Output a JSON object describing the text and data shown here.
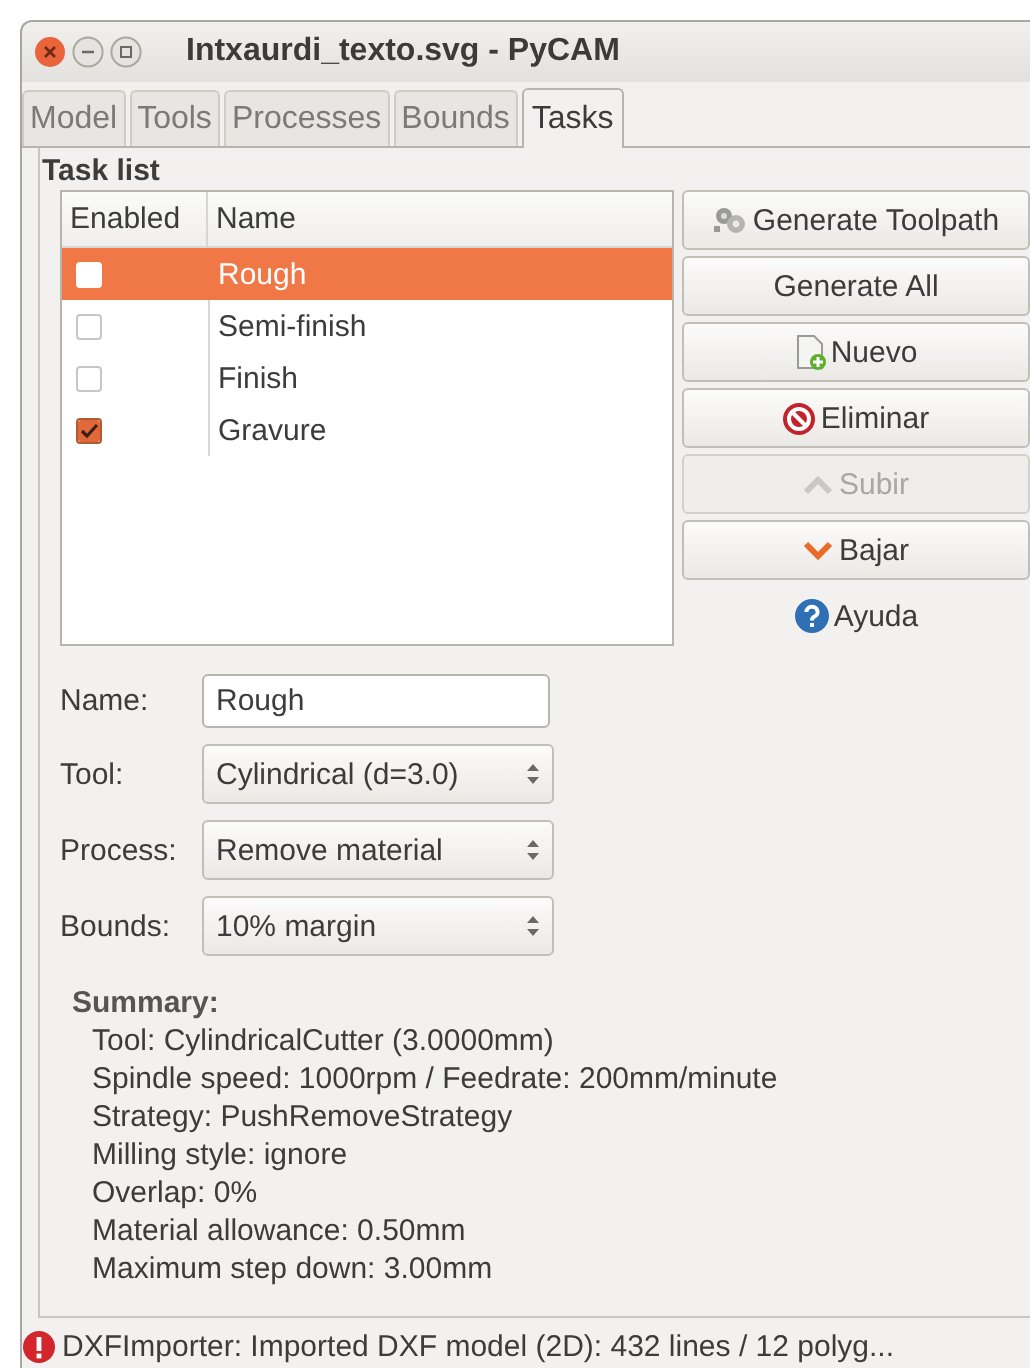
{
  "window": {
    "title": "Intxaurdi_texto.svg - PyCAM"
  },
  "tabs": [
    {
      "label": "Model",
      "selected": false
    },
    {
      "label": "Tools",
      "selected": false
    },
    {
      "label": "Processes",
      "selected": false
    },
    {
      "label": "Bounds",
      "selected": false
    },
    {
      "label": "Tasks",
      "selected": true
    }
  ],
  "task_list": {
    "title": "Task list",
    "columns": [
      "Enabled",
      "Name"
    ],
    "rows": [
      {
        "name": "Rough",
        "enabled": false,
        "selected": true
      },
      {
        "name": "Semi-finish",
        "enabled": false,
        "selected": false
      },
      {
        "name": "Finish",
        "enabled": false,
        "selected": false
      },
      {
        "name": "Gravure",
        "enabled": true,
        "selected": false
      }
    ]
  },
  "buttons": [
    {
      "label": "Generate Toolpath",
      "kind": "gear",
      "disabled": false
    },
    {
      "label": "Generate All",
      "kind": "plain",
      "disabled": false
    },
    {
      "label": "Nuevo",
      "kind": "new",
      "disabled": false
    },
    {
      "label": "Eliminar",
      "kind": "delete",
      "disabled": false
    },
    {
      "label": "Subir",
      "kind": "up",
      "disabled": true
    },
    {
      "label": "Bajar",
      "kind": "down",
      "disabled": false
    },
    {
      "label": "Ayuda",
      "kind": "help",
      "disabled": false
    }
  ],
  "form": [
    {
      "label": "Name:",
      "value": "Rough",
      "kind": "entry"
    },
    {
      "label": "Tool:",
      "value": "Cylindrical (d=3.0)",
      "kind": "combo"
    },
    {
      "label": "Process:",
      "value": "Remove material",
      "kind": "combo"
    },
    {
      "label": "Bounds:",
      "value": "10% margin",
      "kind": "combo"
    }
  ],
  "summary": {
    "title": "Summary:",
    "lines": [
      "Tool: CylindricalCutter (3.0000mm)",
      "Spindle speed: 1000rpm / Feedrate: 200mm/minute",
      "Strategy: PushRemoveStrategy",
      "Milling style: ignore",
      "Overlap: 0%",
      "Material allowance: 0.50mm",
      "Maximum step down: 3.00mm"
    ]
  },
  "status_bar": {
    "text": "DXFImporter: Imported DXF model (2D): 432 lines / 12 polyg..."
  }
}
